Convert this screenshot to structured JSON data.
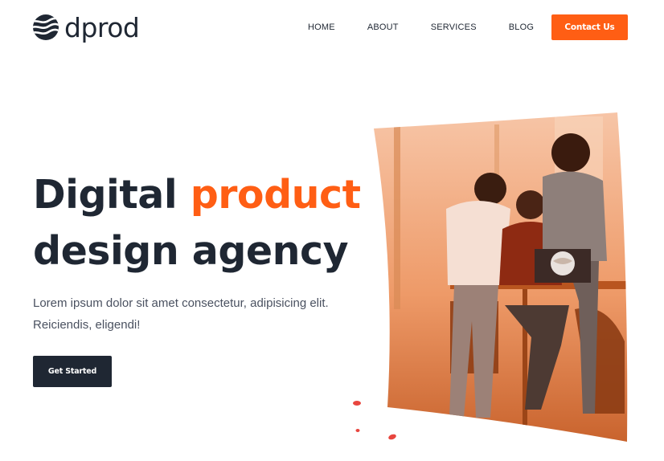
{
  "header": {
    "logo_text": "dprod",
    "nav": [
      "HOME",
      "ABOUT",
      "SERVICES",
      "BLOG"
    ],
    "cta_label": "Contact Us"
  },
  "hero": {
    "title_part1": "Digital ",
    "title_accent": "product",
    "title_part2": "design agency",
    "description_line1": "Lorem ipsum dolor sit amet consectetur, adipisicing elit.",
    "description_line2": "Reiciendis, eligendi!",
    "button_label": "Get Started"
  },
  "colors": {
    "accent": "#ff5e14",
    "dark": "#1f2733",
    "body_text": "#4a5160"
  }
}
